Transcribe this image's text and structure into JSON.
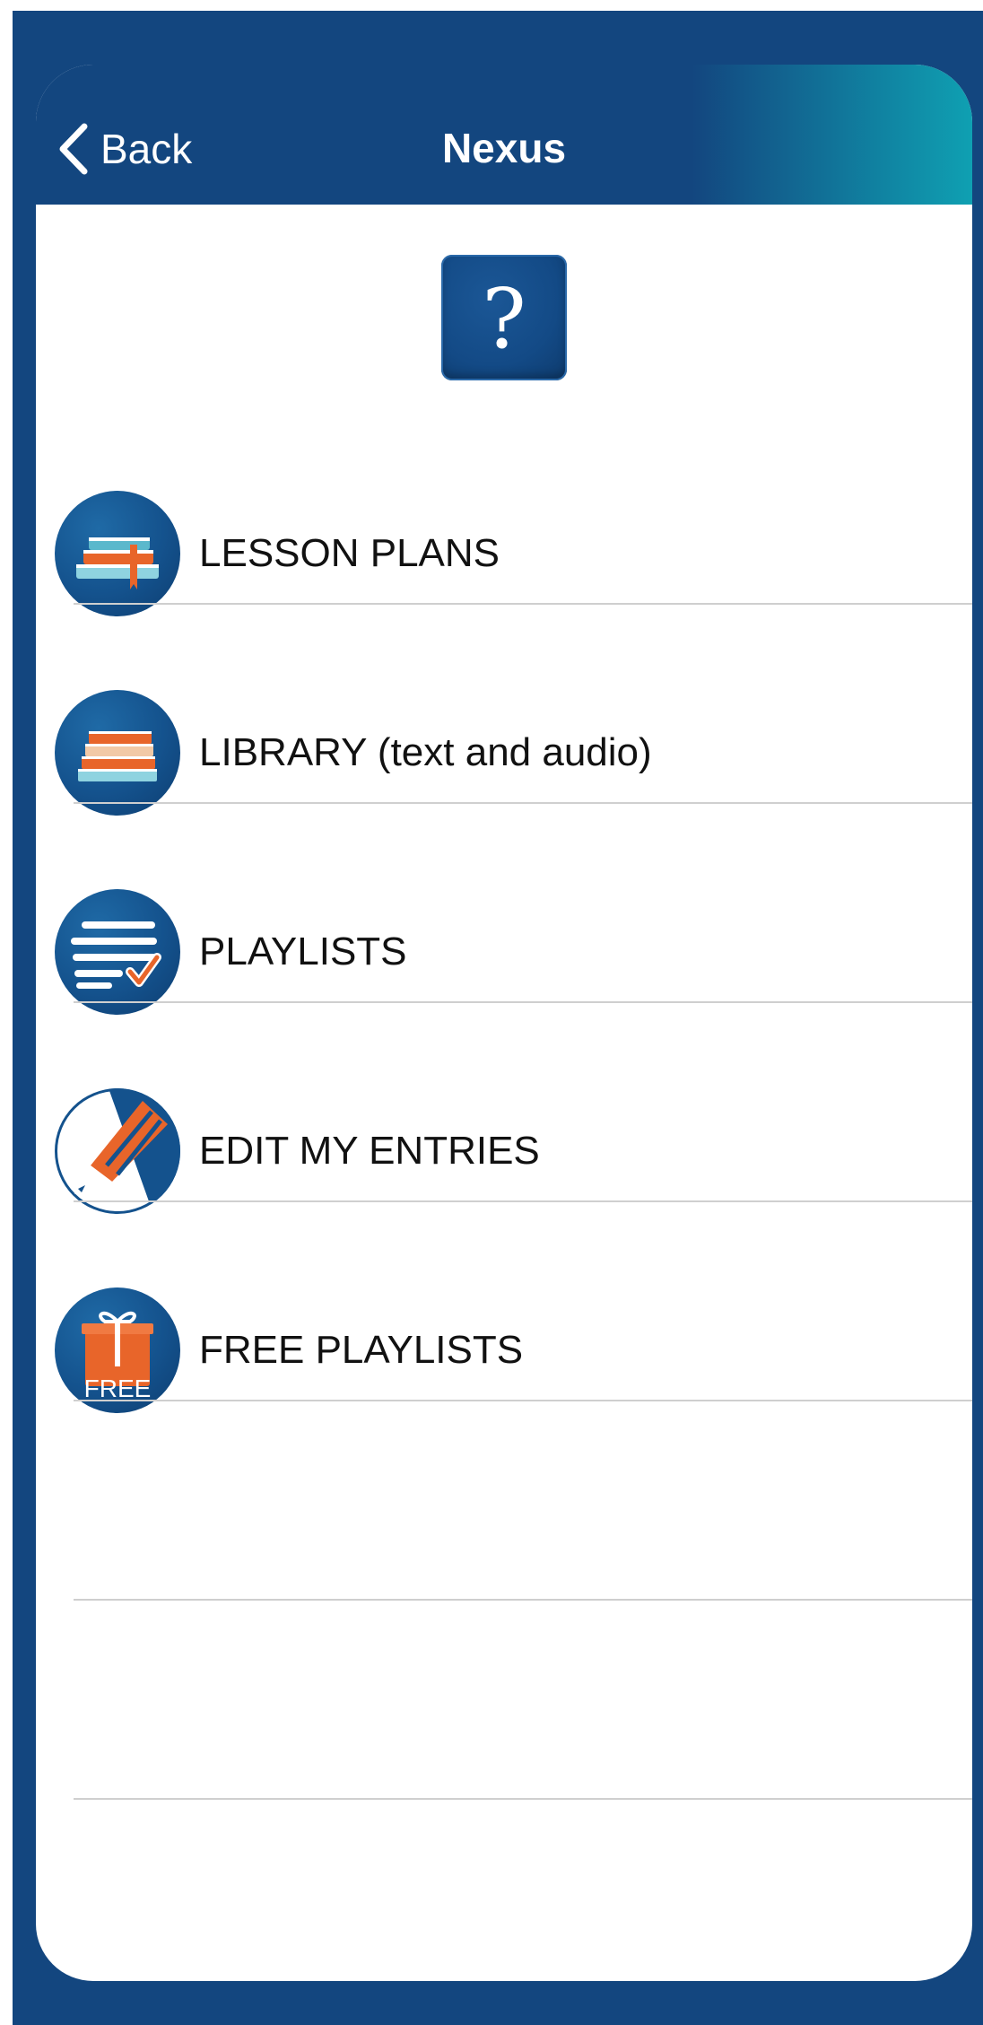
{
  "nav": {
    "back_label": "Back",
    "title": "Nexus"
  },
  "help": {
    "symbol": "?"
  },
  "menu": [
    {
      "label": "LESSON PLANS",
      "icon": "lesson-plans-icon"
    },
    {
      "label": "LIBRARY (text and audio)",
      "icon": "library-icon"
    },
    {
      "label": "PLAYLISTS",
      "icon": "playlists-icon"
    },
    {
      "label": "EDIT MY ENTRIES",
      "icon": "edit-pencil-icon"
    },
    {
      "label": "FREE PLAYLISTS",
      "icon": "free-gift-icon",
      "icon_text": "FREE"
    }
  ],
  "colors": {
    "brand_blue": "#13467f",
    "accent_teal": "#0fa0b2",
    "accent_orange": "#e8652a"
  }
}
